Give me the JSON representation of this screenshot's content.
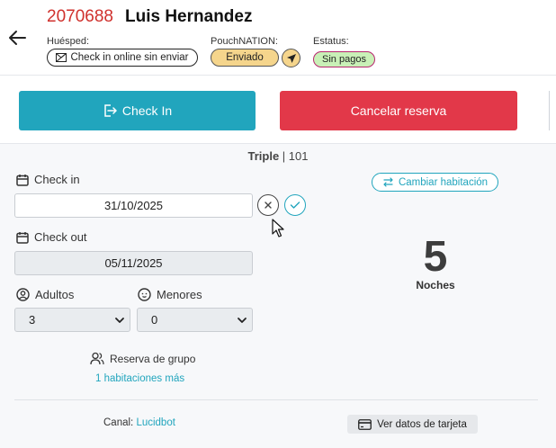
{
  "header": {
    "reservation_number": "2070688",
    "guest_name": "Luis Hernandez",
    "guest_label": "Huésped:",
    "guest_pill": "Check in online sin enviar",
    "pouch_label": "PouchNATION:",
    "pouch_pill": "Enviado",
    "status_label": "Estatus:",
    "status_pill": "Sin pagos"
  },
  "actions": {
    "checkin_label": "Check In",
    "cancel_label": "Cancelar reserva"
  },
  "room": {
    "type": "Triple",
    "separator": " | ",
    "number": "101"
  },
  "checkin": {
    "label": "Check in",
    "value": "31/10/2025"
  },
  "checkout": {
    "label": "Check out",
    "value": "05/11/2025"
  },
  "adults": {
    "label": "Adultos",
    "value": "3"
  },
  "minors": {
    "label": "Menores",
    "value": "0"
  },
  "change_room_label": "Cambiar habitación",
  "nights": {
    "count": "5",
    "label": "Noches"
  },
  "group": {
    "label": "Reserva de grupo",
    "link": "1 habitaciones más"
  },
  "channel": {
    "label": "Canal: ",
    "value": "Lucidbot"
  },
  "card_button_label": "Ver datos de tarjeta",
  "colors": {
    "accent": "#21a5bd",
    "danger": "#e23849",
    "brand_red": "#d0312d",
    "sent": "#f5d58c",
    "no_payment": "#c9f0b7"
  },
  "icons": [
    "back-arrow-icon",
    "mail-off-icon",
    "send-icon",
    "login-icon",
    "calendar-icon",
    "user-circle-icon",
    "baby-icon",
    "swap-icon",
    "users-icon",
    "credit-card-icon",
    "close-icon",
    "check-icon",
    "chevron-down-icon",
    "mouse-cursor-icon"
  ]
}
